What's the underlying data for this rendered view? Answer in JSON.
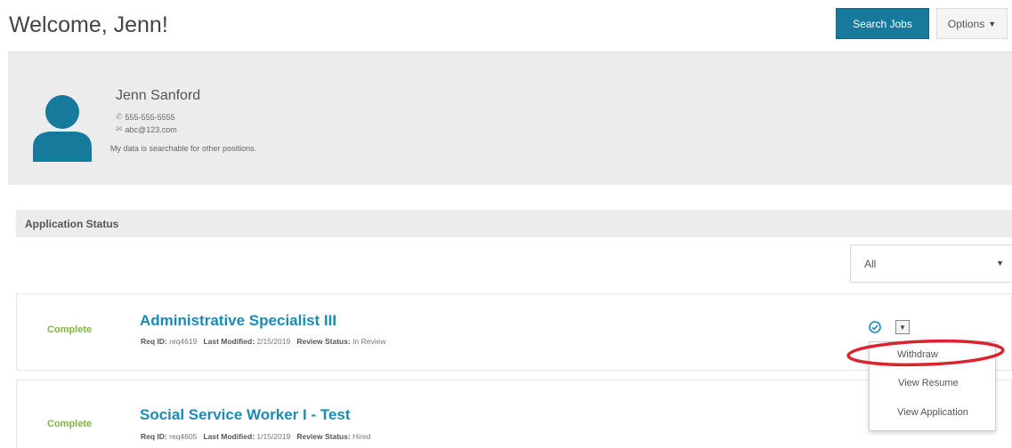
{
  "header": {
    "welcome_title": "Welcome, Jenn!",
    "search_jobs_label": "Search Jobs",
    "options_label": "Options",
    "options_icon": "caret-down-icon"
  },
  "profile": {
    "name": "Jenn Sanford",
    "phone": "555-555-5555",
    "email": "abc@123.com",
    "searchable_note": "My data is searchable for other positions.",
    "phone_icon": "phone-icon",
    "email_icon": "envelope-icon",
    "avatar_icon": "user-avatar-icon",
    "avatar_color": "#157a9c"
  },
  "application_status": {
    "heading": "Application Status",
    "filter_value": "All",
    "applications": [
      {
        "status": "Complete",
        "title": "Administrative Specialist III",
        "req_id_label": "Req ID:",
        "req_id": "req4619",
        "last_modified_label": "Last Modified:",
        "last_modified": "2/15/2019",
        "review_status_label": "Review Status:",
        "review_status": "In Review"
      },
      {
        "status": "Complete",
        "title": "Social Service Worker I - Test",
        "req_id_label": "Req ID:",
        "req_id": "req4605",
        "last_modified_label": "Last Modified:",
        "last_modified": "1/15/2019",
        "review_status_label": "Review Status:",
        "review_status": "Hired"
      }
    ]
  },
  "actions_menu": {
    "items": [
      "Withdraw",
      "View Resume",
      "View Application"
    ],
    "highlight_color": "#d9232e"
  },
  "colors": {
    "accent": "#157a9c",
    "link": "#1b8bb4",
    "status_complete": "#7fb542",
    "panel_bg": "#ececec"
  }
}
